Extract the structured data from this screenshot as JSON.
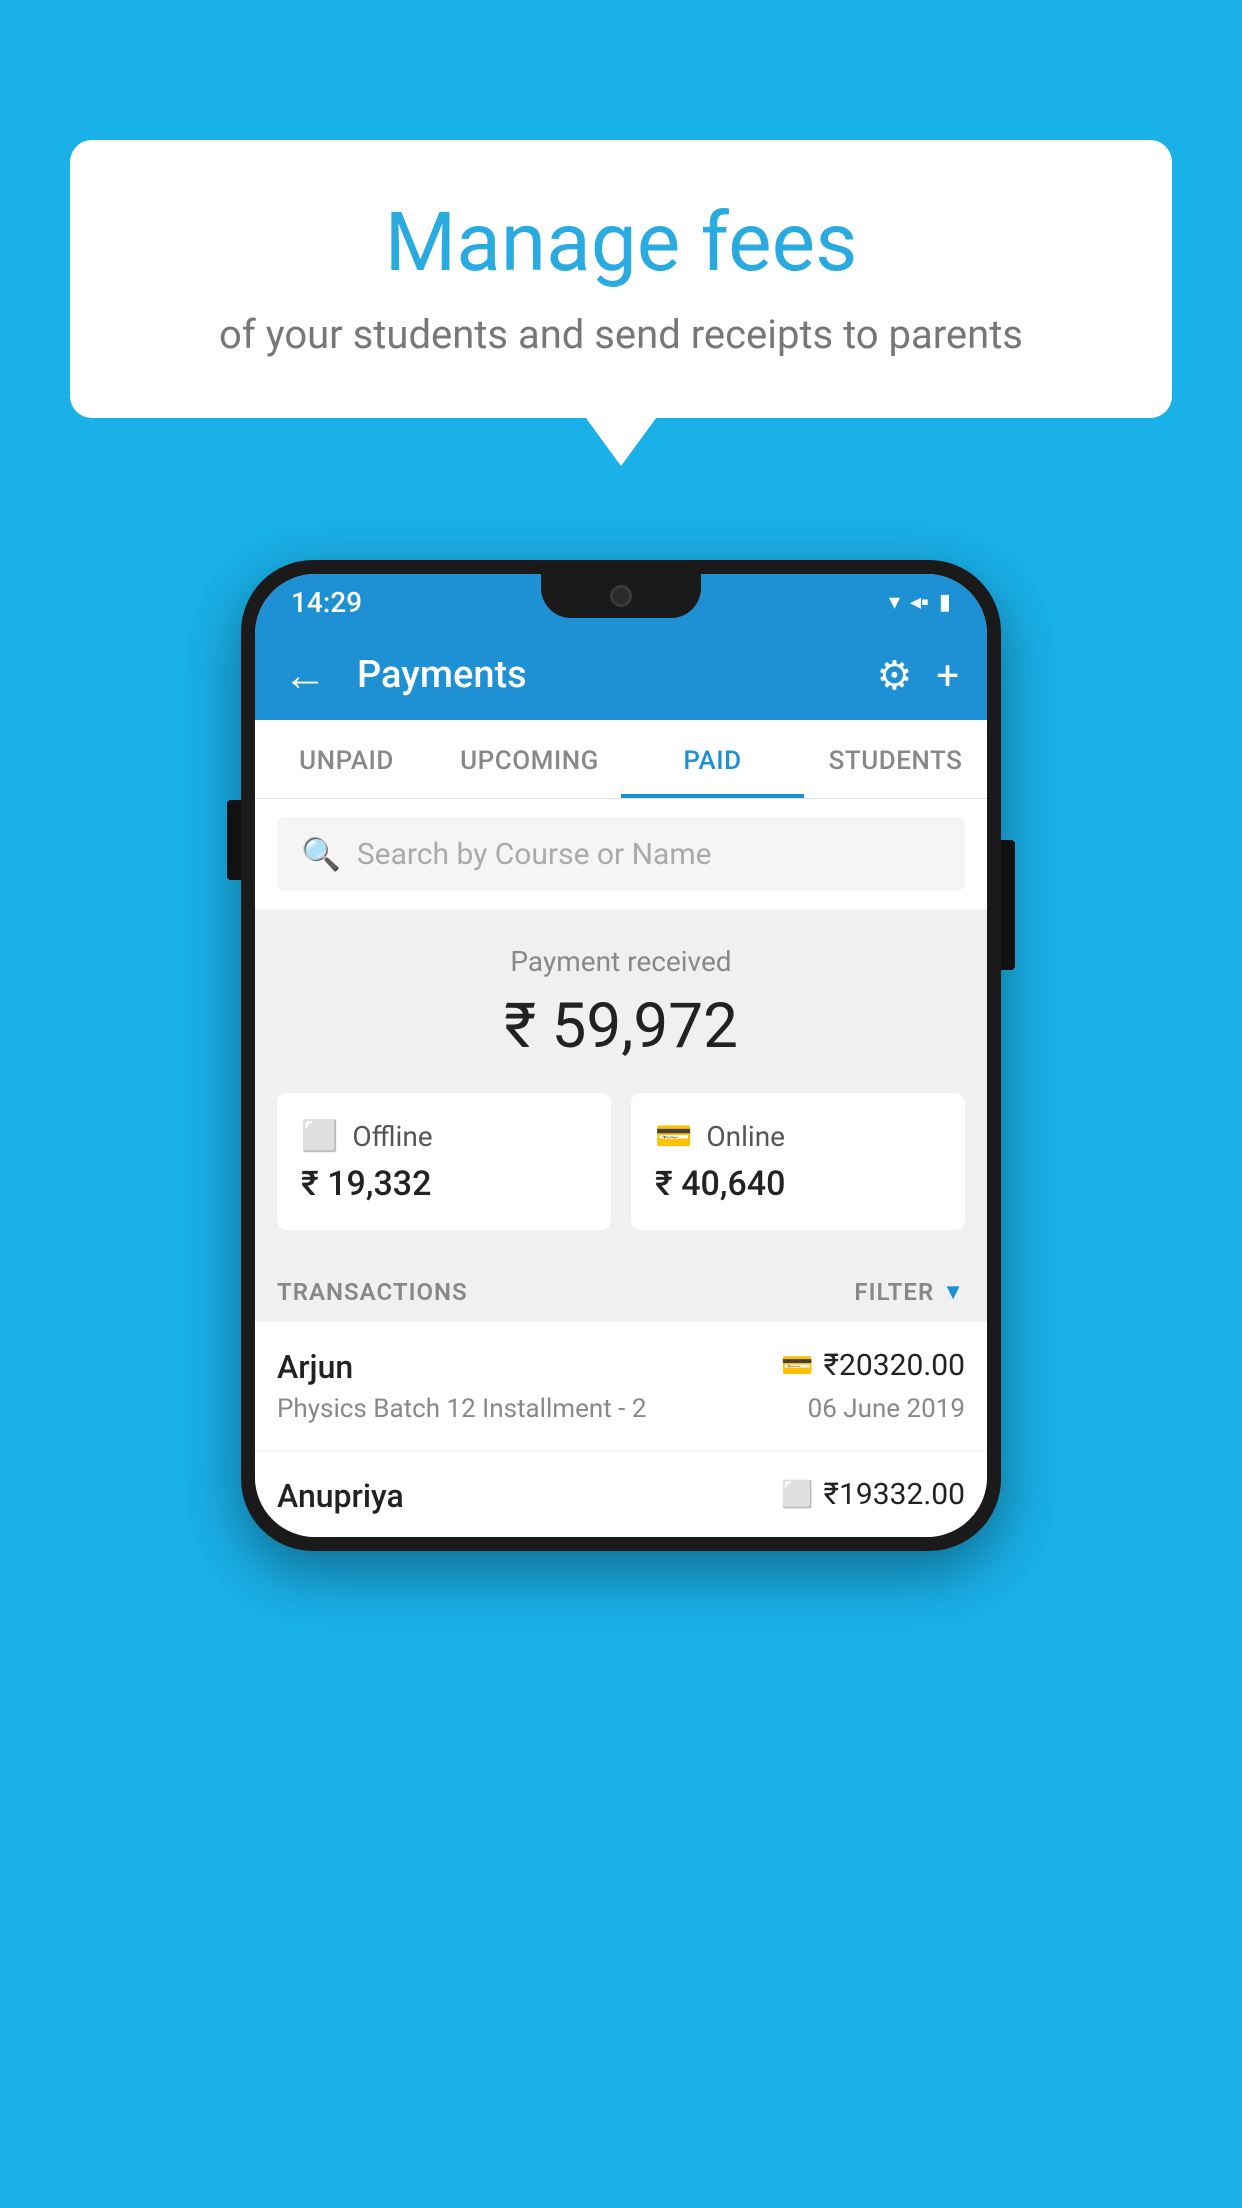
{
  "background_color": "#1ab0e8",
  "speech_bubble": {
    "heading": "Manage fees",
    "subtext": "of your students and send receipts to parents"
  },
  "status_bar": {
    "time": "14:29",
    "icons": [
      "▾◂▪"
    ]
  },
  "app_bar": {
    "title": "Payments",
    "back_icon": "←",
    "settings_icon": "⚙",
    "add_icon": "+"
  },
  "tabs": [
    {
      "label": "UNPAID",
      "active": false
    },
    {
      "label": "UPCOMING",
      "active": false
    },
    {
      "label": "PAID",
      "active": true
    },
    {
      "label": "STUDENTS",
      "active": false
    }
  ],
  "search": {
    "placeholder": "Search by Course or Name"
  },
  "payment_summary": {
    "label": "Payment received",
    "amount": "₹ 59,972"
  },
  "payment_cards": [
    {
      "icon": "offline",
      "label": "Offline",
      "amount": "₹ 19,332"
    },
    {
      "icon": "online",
      "label": "Online",
      "amount": "₹ 40,640"
    }
  ],
  "transactions_section": {
    "label": "TRANSACTIONS",
    "filter_label": "FILTER"
  },
  "transactions": [
    {
      "name": "Arjun",
      "amount": "₹20320.00",
      "course": "Physics Batch 12 Installment - 2",
      "date": "06 June 2019",
      "payment_type": "online"
    },
    {
      "name": "Anupriya",
      "amount": "₹19332.00",
      "course": "",
      "date": "",
      "payment_type": "offline"
    }
  ]
}
